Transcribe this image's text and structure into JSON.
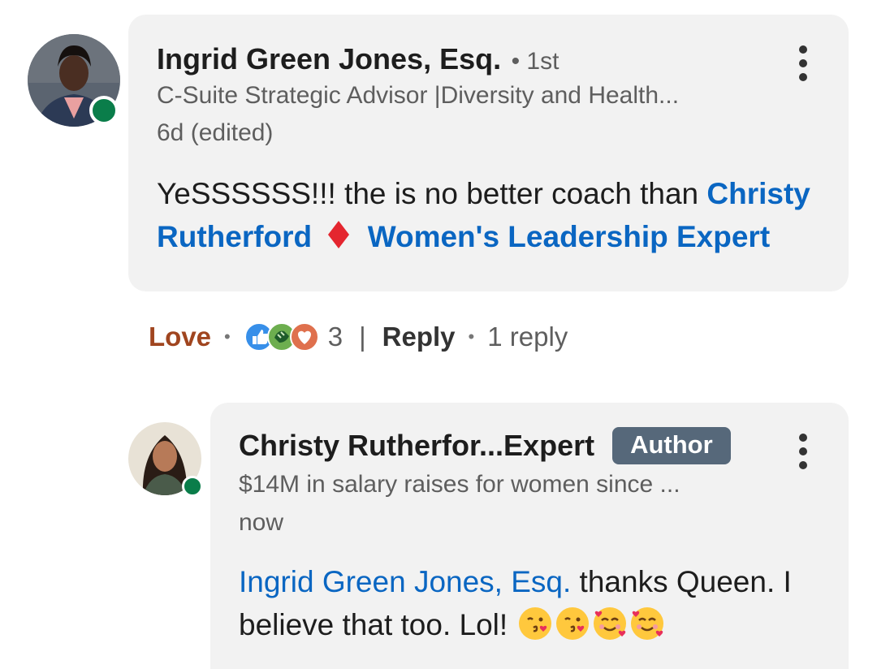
{
  "comment": {
    "author_name": "Ingrid Green Jones, Esq.",
    "degree": "• 1st",
    "headline": "C-Suite Strategic Advisor |Diversity and Health...",
    "timestamp": "6d (edited)",
    "text_lead": "YeSSSSSS!!! the is no better coach than ",
    "mention_line1": "Christy",
    "mention_line2_a": "Rutherford",
    "mention_line2_b": "Women's Leadership Expert",
    "diamond_color": "#e4262f"
  },
  "actions": {
    "love_label": "Love",
    "reaction_count": "3",
    "separator": "|",
    "reply_label": "Reply",
    "reply_count": "1 reply",
    "reaction_icons": [
      "like-icon",
      "support-icon",
      "love-icon"
    ]
  },
  "reply": {
    "author_name": "Christy Rutherfor...Expert",
    "badge": "Author",
    "headline": "$14M in salary raises for women since ...",
    "timestamp": "now",
    "mention": "Ingrid Green Jones, Esq.",
    "text_a": " thanks Queen. I",
    "text_b": "believe that too. Lol!",
    "emojis": [
      "kissing-face-heart-icon",
      "kissing-face-heart-icon",
      "smiling-face-hearts-icon",
      "smiling-face-hearts-icon"
    ]
  },
  "colors": {
    "link_blue": "#0a66c2",
    "love_red": "#a0451f",
    "bubble_bg": "#f2f2f2",
    "badge_bg": "#56687a",
    "presence_green": "#0a7d4a"
  }
}
